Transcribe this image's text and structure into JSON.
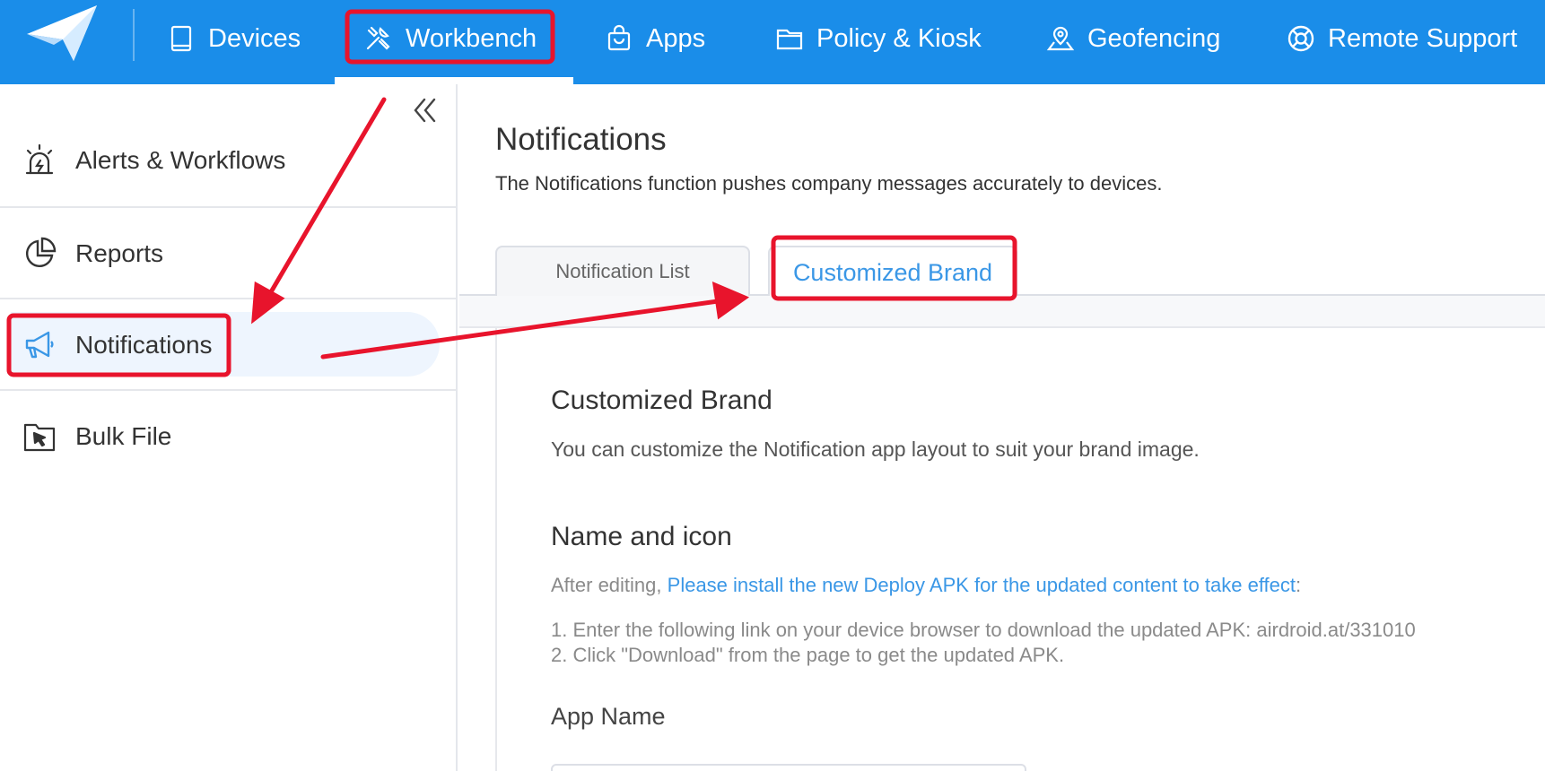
{
  "nav": {
    "items": [
      {
        "label": "Devices",
        "icon": "tablet-icon"
      },
      {
        "label": "Workbench",
        "icon": "tools-icon"
      },
      {
        "label": "Apps",
        "icon": "shopping-bag-icon"
      },
      {
        "label": "Policy & Kiosk",
        "icon": "folder-icon"
      },
      {
        "label": "Geofencing",
        "icon": "map-pin-icon"
      },
      {
        "label": "Remote Support",
        "icon": "lifebuoy-icon"
      }
    ],
    "active": "Workbench"
  },
  "sidebar": {
    "items": [
      {
        "label": "Alerts & Workflows",
        "icon": "alarm-icon"
      },
      {
        "label": "Reports",
        "icon": "pie-chart-icon"
      },
      {
        "label": "Notifications",
        "icon": "megaphone-icon"
      },
      {
        "label": "Bulk File",
        "icon": "folder-cursor-icon"
      }
    ],
    "active": "Notifications"
  },
  "main": {
    "title": "Notifications",
    "description": "The Notifications function pushes company messages accurately to devices.",
    "tabs": [
      {
        "label": "Notification List"
      },
      {
        "label": "Customized Brand"
      }
    ],
    "active_tab": "Customized Brand",
    "brand": {
      "title": "Customized Brand",
      "description": "You can customize the Notification app layout to suit your brand image.",
      "name_icon_title": "Name and icon",
      "after_editing": "After editing, ",
      "install_link": "Please install the new Deploy APK for the updated content to take effect",
      "colon": ":",
      "step1": "1. Enter the following link on your device browser to download the updated APK: airdroid.at/331010",
      "step2": "2. Click \"Download\" from the page to get the updated APK.",
      "app_name_label": "App Name"
    }
  },
  "colors": {
    "nav_bg": "#1a8de9",
    "accent": "#3a97e6",
    "annotation": "#e8142c"
  }
}
